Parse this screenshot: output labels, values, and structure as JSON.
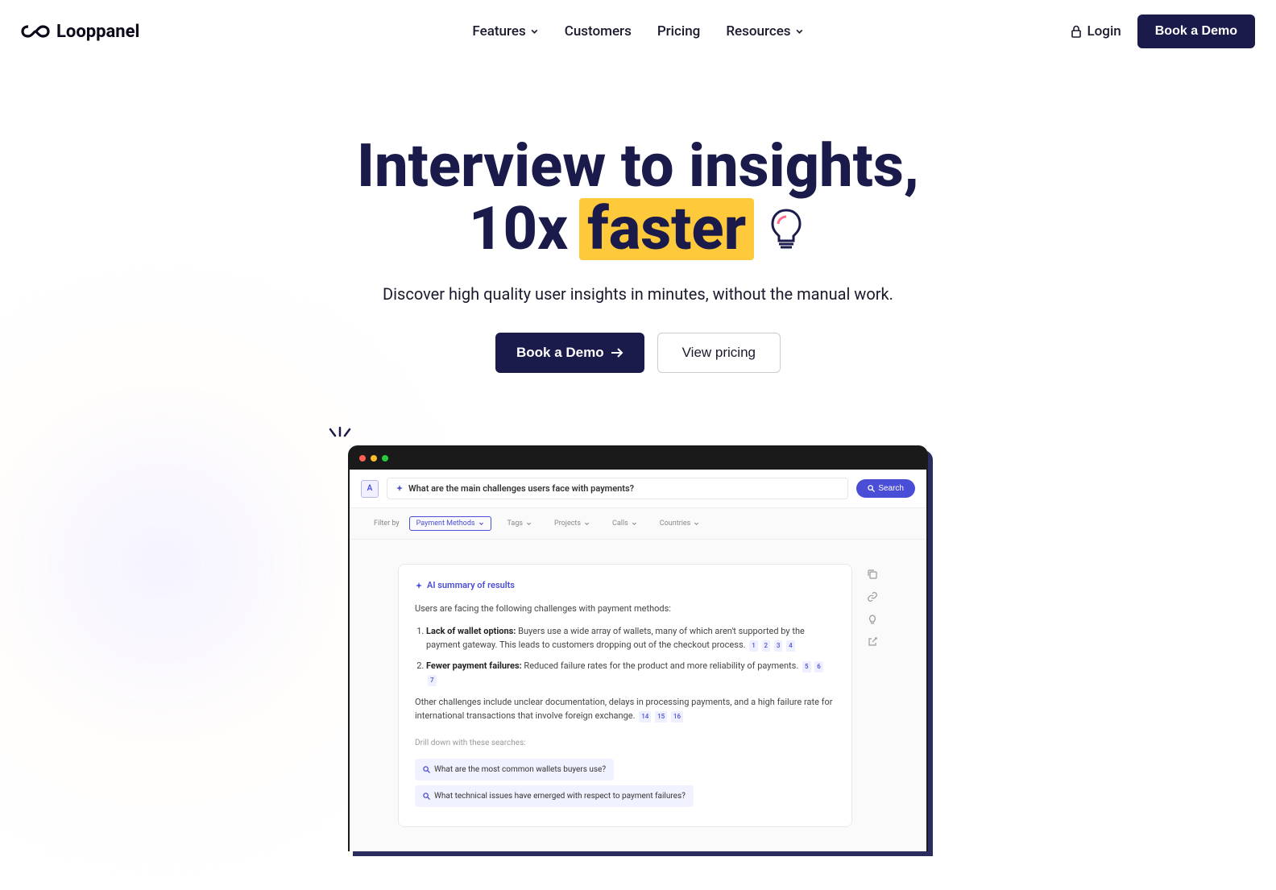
{
  "header": {
    "brand": "Looppanel",
    "nav": {
      "features": "Features",
      "customers": "Customers",
      "pricing": "Pricing",
      "resources": "Resources"
    },
    "login": "Login",
    "demo": "Book a Demo"
  },
  "hero": {
    "line1": "Interview to insights,",
    "line2_prefix": "10x",
    "line2_highlight": "faster",
    "subtitle": "Discover high quality user insights in minutes, without the manual work.",
    "cta_primary": "Book a Demo",
    "cta_secondary": "View pricing"
  },
  "app": {
    "badge": "A",
    "search_query": "What are the main challenges users face with payments?",
    "search_button": "Search",
    "filter_label": "Filter by",
    "filters": {
      "payment": "Payment Methods",
      "tags": "Tags",
      "projects": "Projects",
      "calls": "Calls",
      "countries": "Countries"
    },
    "summary": {
      "title": "AI summary of results",
      "intro": "Users are facing the following challenges with payment methods:",
      "item1_title": "Lack of wallet options:",
      "item1_body": " Buyers use a wide array of wallets, many of which aren't supported by the payment gateway. This leads to customers dropping out of the checkout process.",
      "item1_refs": [
        "1",
        "2",
        "3",
        "4"
      ],
      "item2_title": "Fewer payment failures:",
      "item2_body": " Reduced failure rates for the product and more reliability of payments.",
      "item2_refs": [
        "5",
        "6",
        "7"
      ],
      "other": "Other challenges include unclear documentation, delays in processing payments, and a high failure rate for international transactions that involve foreign exchange.",
      "other_refs": [
        "14",
        "15",
        "16"
      ],
      "drill_label": "Drill down with these searches:",
      "drill1": "What are the most common wallets buyers use?",
      "drill2": "What technical issues have emerged with respect to payment failures?"
    }
  }
}
